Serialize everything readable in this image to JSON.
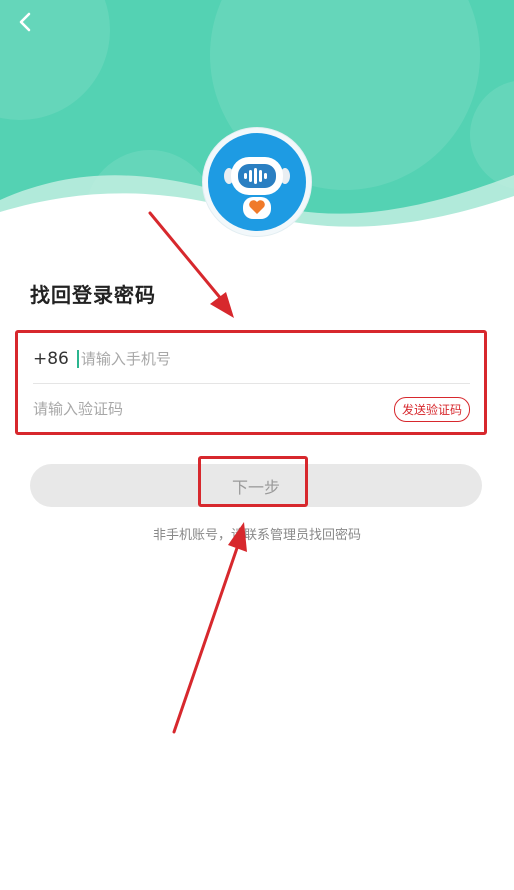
{
  "header": {
    "back_icon": "chevron-left-icon",
    "avatar_icon": "robot-mascot-icon",
    "background_color": "#54d2b3"
  },
  "page": {
    "title": "找回登录密码"
  },
  "form": {
    "country_code": "+86",
    "phone_placeholder": "请输入手机号",
    "code_placeholder": "请输入验证码",
    "send_code_label": "发送验证码"
  },
  "actions": {
    "next_label": "下一步"
  },
  "footer": {
    "note": "非手机账号，请联系管理员找回密码"
  },
  "annotation": {
    "color": "#d7282d"
  }
}
